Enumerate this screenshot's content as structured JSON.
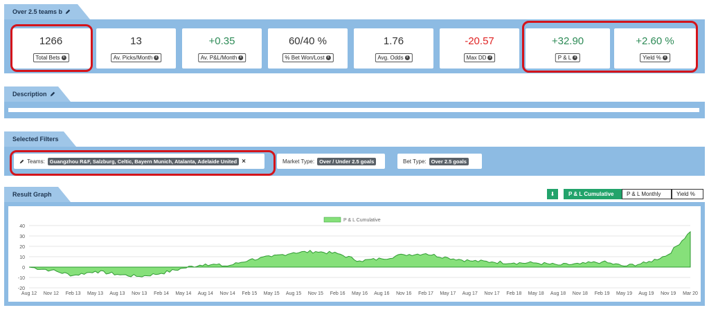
{
  "strategy": {
    "title": "Over 2.5 teams b"
  },
  "stats": [
    {
      "value": "1266",
      "label": "Total Bets",
      "tone": "neutral"
    },
    {
      "value": "13",
      "label": "Av. Picks/Month",
      "tone": "neutral"
    },
    {
      "value": "+0.35",
      "label": "Av. P&L/Month",
      "tone": "pos"
    },
    {
      "value": "60/40 %",
      "label": "% Bet Won/Lost",
      "tone": "neutral"
    },
    {
      "value": "1.76",
      "label": "Avg. Odds",
      "tone": "neutral"
    },
    {
      "value": "-20.57",
      "label": "Max DD",
      "tone": "neg"
    },
    {
      "value": "+32.90",
      "label": "P & L",
      "tone": "pos"
    },
    {
      "value": "+2.60 %",
      "label": "Yield %",
      "tone": "pos"
    }
  ],
  "description": {
    "title": "Description"
  },
  "filters": {
    "title": "Selected Filters",
    "teams_label": "Teams:",
    "teams_value": "Guangzhou R&F, Salzburg, Celtic, Bayern Munich, Atalanta, Adelaide United",
    "remove_glyph": "×",
    "market_label": "Market Type:",
    "market_value": "Over / Under 2.5 goals",
    "bet_label": "Bet Type:",
    "bet_value": "Over 2.5 goals"
  },
  "graph": {
    "title": "Result Graph",
    "download_glyph": "⬇",
    "buttons": [
      "P & L Cumulative",
      "P & L Monthly",
      "Yield %"
    ],
    "active_button": 0
  },
  "colors": {
    "band": "#8dbbe3",
    "tab": "#9fc6e8",
    "positive": "#2e8b57",
    "negative": "#e02424",
    "highlight_ring": "#d4141b",
    "area_fill": "#86e07a",
    "area_stroke": "#2f9a32",
    "active_button": "#22a36b"
  },
  "chart_data": {
    "type": "area",
    "legend": "P & L Cumulative",
    "legend_position": "top-center",
    "grid": true,
    "ylim": [
      -20,
      40
    ],
    "yticks": [
      -20,
      -10,
      0,
      10,
      20,
      30,
      40
    ],
    "x": [
      "Aug 12",
      "Nov 12",
      "Feb 13",
      "May 13",
      "Aug 13",
      "Nov 13",
      "Feb 14",
      "May 14",
      "Aug 14",
      "Nov 14",
      "Feb 15",
      "May 15",
      "Aug 15",
      "Nov 15",
      "Feb 16",
      "May 16",
      "Aug 16",
      "Nov 16",
      "Feb 17",
      "May 17",
      "Aug 17",
      "Nov 17",
      "Feb 18",
      "May 18",
      "Aug 18",
      "Nov 18",
      "Feb 19",
      "May 19",
      "Aug 19",
      "Nov 19",
      "Mar 20"
    ],
    "values": [
      0,
      -3,
      -8,
      -4,
      -7,
      -9,
      -6,
      -1,
      3,
      1,
      7,
      10,
      14,
      15,
      13,
      6,
      8,
      12,
      13,
      9,
      6,
      5,
      4,
      4,
      2,
      3,
      5,
      1,
      4,
      12,
      34
    ]
  }
}
